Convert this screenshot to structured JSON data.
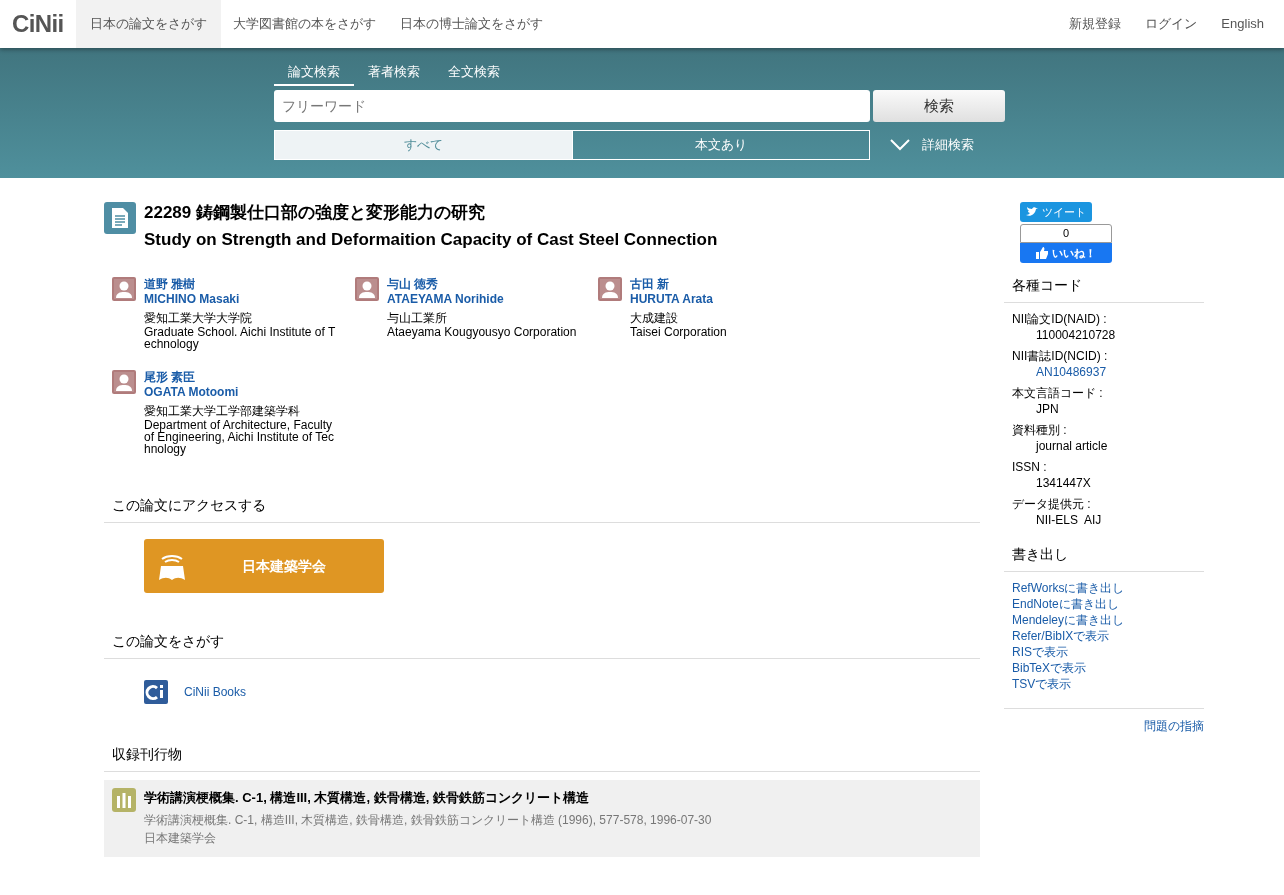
{
  "header": {
    "logo": "CiNii",
    "nav": [
      {
        "label": "日本の論文をさがす",
        "selected": true
      },
      {
        "label": "大学図書館の本をさがす",
        "selected": false
      },
      {
        "label": "日本の博士論文をさがす",
        "selected": false
      }
    ],
    "links": [
      "新規登録",
      "ログイン",
      "English"
    ]
  },
  "search": {
    "tabs": [
      {
        "label": "論文検索",
        "selected": true
      },
      {
        "label": "著者検索",
        "selected": false
      },
      {
        "label": "全文検索",
        "selected": false
      }
    ],
    "placeholder": "フリーワード",
    "button": "検索",
    "filters": [
      {
        "label": "すべて",
        "selected": true
      },
      {
        "label": "本文あり",
        "selected": false
      }
    ],
    "advanced": "詳細検索"
  },
  "article": {
    "title_ja": "22289 鋳鋼製仕口部の強度と変形能力の研究",
    "title_en": "Study on Strength and Deformaition Capacity of Cast Steel Connection"
  },
  "authors": [
    {
      "name_ja": "道野 雅樹",
      "name_en": "MICHINO Masaki",
      "affil_ja": "愛知工業大学大学院",
      "affil_en": "Graduate School. Aichi Institute of Technology"
    },
    {
      "name_ja": "与山 徳秀",
      "name_en": "ATAEYAMA Norihide",
      "affil_ja": "与山工業所",
      "affil_en": "Ataeyama Kougyousyo Corporation"
    },
    {
      "name_ja": "古田 新",
      "name_en": "HURUTA Arata",
      "affil_ja": "大成建設",
      "affil_en": "Taisei Corporation"
    },
    {
      "name_ja": "尾形 素臣",
      "name_en": "OGATA Motoomi",
      "affil_ja": "愛知工業大学工学部建築学科",
      "affil_en": "Department of Architecture, Faculty of Engineering, Aichi Institute of Technology"
    }
  ],
  "access": {
    "heading": "この論文にアクセスする",
    "button": "日本建築学会"
  },
  "find": {
    "heading": "この論文をさがす",
    "link": "CiNii Books"
  },
  "journal": {
    "heading": "収録刊行物",
    "title": "学術講演梗概集. C-1, 構造III, 木質構造, 鉄骨構造, 鉄骨鉄筋コンクリート構造",
    "detail": "学術講演梗概集. C-1, 構造III, 木質構造, 鉄骨構造, 鉄骨鉄筋コンクリート構造 (1996), 577-578, 1996-07-30",
    "publisher": "日本建築学会"
  },
  "sidebar": {
    "tweet": "ツイート",
    "like_count": "0",
    "like": "いいね！",
    "codes_heading": "各種コード",
    "codes": [
      {
        "label": "NII論文ID(NAID) :",
        "value": "110004210728",
        "kind": "text"
      },
      {
        "label": "NII書誌ID(NCID) :",
        "value": "AN10486937",
        "kind": "link"
      },
      {
        "label": "本文言語コード :",
        "value": "JPN",
        "kind": "text"
      },
      {
        "label": "資料種別 :",
        "value": "journal article",
        "kind": "text"
      },
      {
        "label": "ISSN :",
        "value": "1341447X",
        "kind": "text"
      },
      {
        "label": "データ提供元 :",
        "value": "NII-ELS  AIJ",
        "kind": "text"
      }
    ],
    "export_heading": "書き出し",
    "exports": [
      "RefWorksに書き出し",
      "EndNoteに書き出し",
      "Mendeleyに書き出し",
      "Refer/BibIXで表示",
      "RISで表示",
      "BibTeXで表示",
      "TSVで表示"
    ],
    "report": "問題の指摘"
  }
}
